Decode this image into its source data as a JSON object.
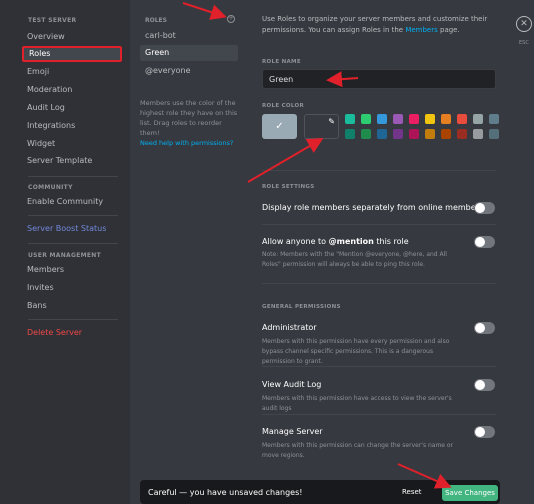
{
  "sidebar": {
    "server_header": "TEST SERVER",
    "items": [
      {
        "label": "Overview"
      },
      {
        "label": "Roles"
      },
      {
        "label": "Emoji"
      },
      {
        "label": "Moderation"
      },
      {
        "label": "Audit Log"
      },
      {
        "label": "Integrations"
      },
      {
        "label": "Widget"
      },
      {
        "label": "Server Template"
      }
    ],
    "community_header": "COMMUNITY",
    "community_items": [
      {
        "label": "Enable Community"
      }
    ],
    "boost_label": "Server Boost Status",
    "user_mgmt_header": "USER MANAGEMENT",
    "user_items": [
      {
        "label": "Members"
      },
      {
        "label": "Invites"
      },
      {
        "label": "Bans"
      }
    ],
    "delete_label": "Delete Server"
  },
  "roles": {
    "header": "ROLES",
    "items": [
      {
        "label": "carl-bot"
      },
      {
        "label": "Green"
      },
      {
        "label": "@everyone"
      }
    ],
    "note": "Members use the color of the highest role they have on this list. Drag roles to reorder them!",
    "help_link": "Need help with permissions?"
  },
  "settings": {
    "intro_text": "Use Roles to organize your server members and customize their permissions. You can assign Roles in the ",
    "intro_link": "Members",
    "intro_tail": " page.",
    "role_name_label": "ROLE NAME",
    "role_name_value": "Green",
    "role_color_label": "ROLE COLOR",
    "swatch_colors_top": [
      "#1abc9c",
      "#2ecc71",
      "#3498db",
      "#9b59b6",
      "#e91e63",
      "#f1c40f",
      "#e67e22",
      "#e74c3c",
      "#95a5a6",
      "#607d8b"
    ],
    "swatch_colors_bottom": [
      "#11806a",
      "#1f8b4c",
      "#206694",
      "#71368a",
      "#ad1457",
      "#c27c0e",
      "#a84300",
      "#992d22",
      "#979c9f",
      "#546e7a"
    ],
    "role_settings_label": "ROLE SETTINGS",
    "display_separately": "Display role members separately from online members",
    "mention_title_pre": "Allow anyone to ",
    "mention_title_bold": "@mention",
    "mention_title_post": " this role",
    "mention_note": "Note: Members with the \"Mention @everyone, @here, and All Roles\" permission will always be able to ping this role.",
    "general_permissions_label": "GENERAL PERMISSIONS",
    "perms": [
      {
        "title": "Administrator",
        "desc": "Members with this permission have every permission and also bypass channel specific permissions. This is a dangerous permission to grant."
      },
      {
        "title": "View Audit Log",
        "desc": "Members with this permission have access to view the server's audit logs"
      },
      {
        "title": "Manage Server",
        "desc": "Members with this permission can change the server's name or move regions."
      }
    ]
  },
  "close": {
    "icon": "close-icon",
    "label": "ESC"
  },
  "unsaved_bar": {
    "message": "Careful — you have unsaved changes!",
    "reset_label": "Reset",
    "save_label": "Save Changes"
  }
}
